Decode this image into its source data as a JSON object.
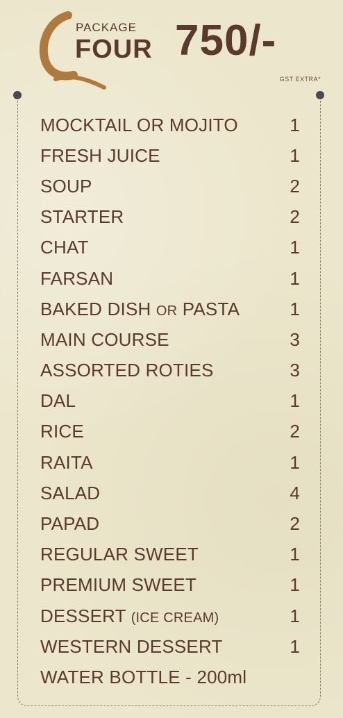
{
  "header": {
    "package_label": "PACKAGE",
    "package_name": "FOUR",
    "price": "750/-",
    "tax_note": "GST EXTRA*"
  },
  "colors": {
    "text_brown": "#5a3a2c",
    "logo_gold": "#b07a3e",
    "background": "#ece6cc",
    "dot": "#4a4a52"
  },
  "items": [
    {
      "name": "MOCKTAIL OR MOJITO",
      "qty": "1"
    },
    {
      "name": "FRESH JUICE",
      "qty": "1"
    },
    {
      "name": "SOUP",
      "qty": "2"
    },
    {
      "name": "STARTER",
      "qty": "2"
    },
    {
      "name": "CHAT",
      "qty": "1"
    },
    {
      "name": "FARSAN",
      "qty": "1"
    },
    {
      "name_part1": "BAKED DISH ",
      "name_part2": "OR",
      "name_part3": " PASTA",
      "qty": "1"
    },
    {
      "name": "MAIN COURSE",
      "qty": "3"
    },
    {
      "name": "ASSORTED ROTIES",
      "qty": "3"
    },
    {
      "name": "DAL",
      "qty": "1"
    },
    {
      "name": "RICE",
      "qty": "2"
    },
    {
      "name": "RAITA",
      "qty": "1"
    },
    {
      "name": "SALAD",
      "qty": "4"
    },
    {
      "name": "PAPAD",
      "qty": "2"
    },
    {
      "name": "REGULAR SWEET",
      "qty": "1"
    },
    {
      "name": "PREMIUM SWEET",
      "qty": "1"
    },
    {
      "name_part1": "DESSERT ",
      "name_part2": "(ICE CREAM)",
      "qty": "1"
    },
    {
      "name": "WESTERN DESSERT",
      "qty": "1"
    },
    {
      "name": "WATER BOTTLE - 200ml",
      "qty": ""
    }
  ]
}
